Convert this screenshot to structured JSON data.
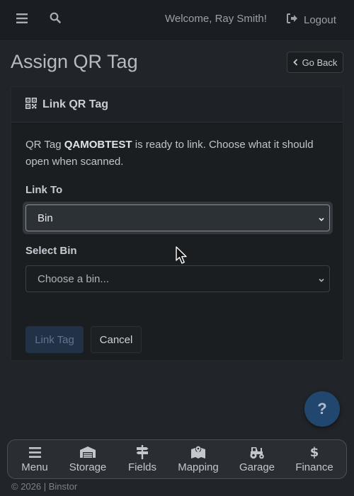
{
  "topbar": {
    "menu_icon": "hamburger-icon",
    "search_icon": "search-icon",
    "welcome": "Welcome, Ray Smith!",
    "logout_label": "Logout"
  },
  "page": {
    "title": "Assign QR Tag",
    "go_back_label": "Go Back"
  },
  "card": {
    "title": "Link QR Tag",
    "intro_prefix": "QR Tag ",
    "tag_code": "QAMOBTEST",
    "intro_suffix": " is ready to link. Choose what it should open when scanned.",
    "link_to_label": "Link To",
    "link_to_value": "Bin",
    "select_bin_label": "Select Bin",
    "select_bin_placeholder": "Choose a bin...",
    "link_button": "Link Tag",
    "cancel_button": "Cancel"
  },
  "help": {
    "label": "?"
  },
  "bottom_nav": [
    {
      "label": "Menu",
      "icon": "menu-icon"
    },
    {
      "label": "Storage",
      "icon": "warehouse-icon"
    },
    {
      "label": "Fields",
      "icon": "signpost-icon"
    },
    {
      "label": "Mapping",
      "icon": "map-marker-icon"
    },
    {
      "label": "Garage",
      "icon": "tractor-icon"
    },
    {
      "label": "Finance",
      "icon": "dollar-icon"
    }
  ],
  "footer": "© 2026 | Binstor",
  "colors": {
    "background": "#212529",
    "card": "#1b1e21",
    "primary_disabled": "#213247",
    "help_button": "#21476e"
  }
}
